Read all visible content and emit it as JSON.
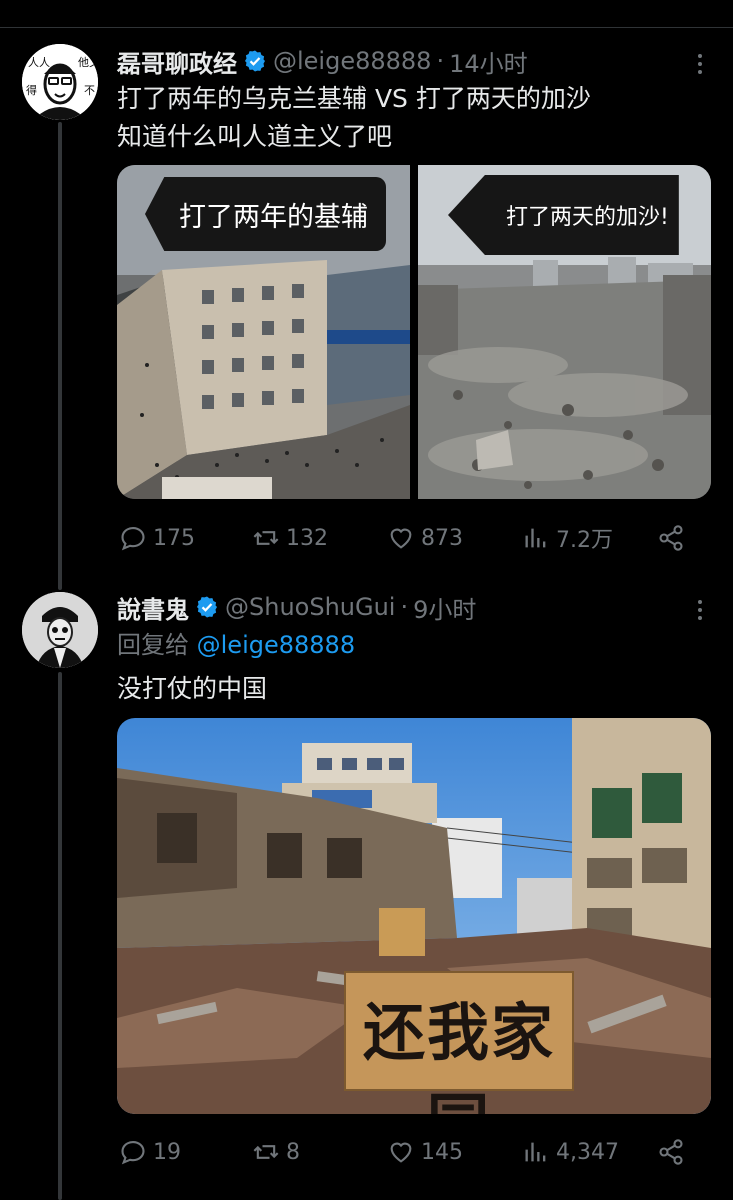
{
  "tweet1": {
    "name": "磊哥聊政经",
    "handle": "@leige88888",
    "dot": "·",
    "time": "14小时",
    "text_line1": "打了两年的乌克兰基辅 VS 打了两天的加沙",
    "text_line2": "知道什么叫人道主义了吧",
    "image_left_caption": "打了两年的基辅",
    "image_right_caption": "打了两天的加沙!",
    "avatar_text": [
      "人人",
      "他又",
      "得",
      "不"
    ],
    "replies": "175",
    "reposts": "132",
    "likes": "873",
    "views": "7.2万"
  },
  "tweet2": {
    "name": "說書鬼",
    "handle": "@ShuoShuGui",
    "dot": "·",
    "time": "9小时",
    "reply_label": "回复给",
    "reply_mention": "@leige88888",
    "text": "没打仗的中国",
    "sign_text": "还我家园",
    "replies": "19",
    "reposts": "8",
    "likes": "145",
    "views": "4,347"
  },
  "icons": {
    "verified": "verified-badge-icon",
    "reply": "reply-icon",
    "repost": "repost-icon",
    "like": "heart-icon",
    "views": "views-chart-icon",
    "share": "share-icon",
    "more": "more-dots-icon"
  },
  "colors": {
    "background": "#000000",
    "text": "#e7e9ea",
    "muted": "#71767b",
    "accent": "#1d9bf0"
  }
}
